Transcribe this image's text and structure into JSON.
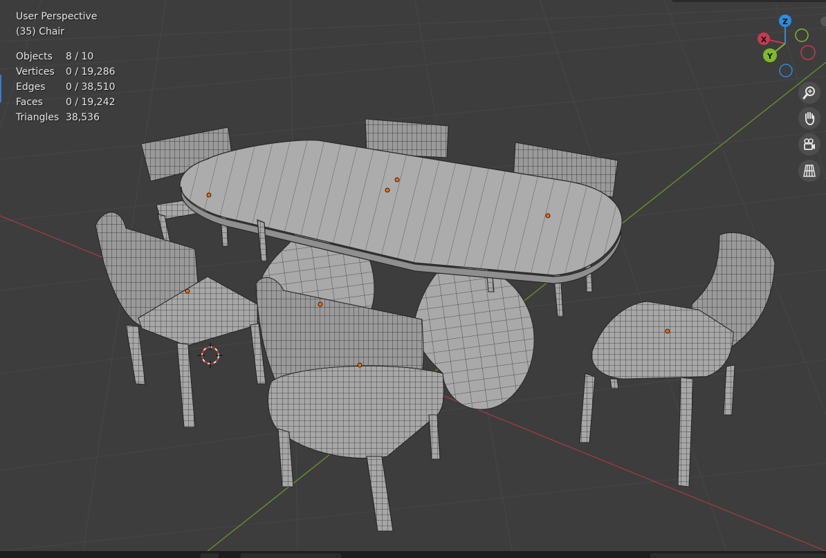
{
  "viewport": {
    "view_name": "User Perspective",
    "active_object": "(35) Chair"
  },
  "stats": [
    {
      "label": "Objects",
      "value": "8 / 10"
    },
    {
      "label": "Vertices",
      "value": "0 / 19,286"
    },
    {
      "label": "Edges",
      "value": "0 / 38,510"
    },
    {
      "label": "Faces",
      "value": "0 / 19,242"
    },
    {
      "label": "Triangles",
      "value": "38,536"
    }
  ],
  "gizmo": {
    "x_label": "X",
    "y_label": "Y",
    "z_label": "Z",
    "x_color": "#c9394f",
    "y_color": "#7fba29",
    "z_color": "#2c8ce0"
  },
  "nav_buttons": [
    {
      "name": "zoom-button",
      "icon": "zoom-icon"
    },
    {
      "name": "pan-button",
      "icon": "hand-icon"
    },
    {
      "name": "camera-view-button",
      "icon": "camera-icon"
    },
    {
      "name": "perspective-toggle-button",
      "icon": "grid-icon"
    }
  ],
  "colors": {
    "background": "#3d3d3d",
    "grid": "#4a4a4a",
    "axis_x": "#a83c44",
    "axis_y": "#6c9a2a",
    "mesh_fill": "#a6a6a6",
    "wire": "#2a2a2a",
    "origin_dot": "#ff6a00"
  }
}
